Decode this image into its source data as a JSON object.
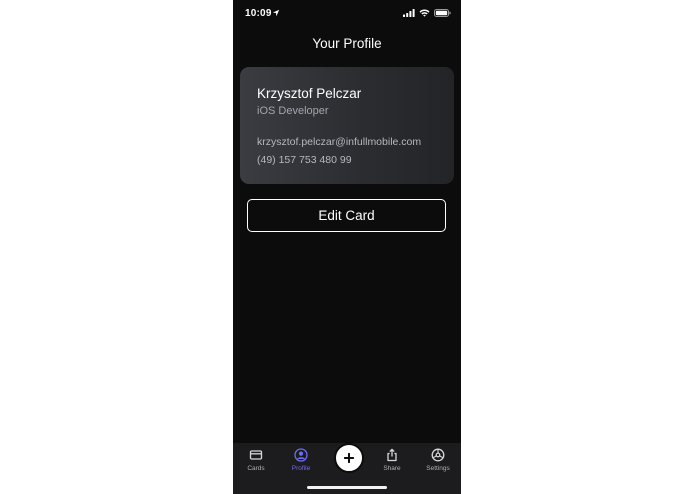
{
  "status_bar": {
    "time": "10:09",
    "location_icon": "location-arrow-icon",
    "signal_icon": "cellular-signal-icon",
    "wifi_icon": "wifi-icon",
    "battery_icon": "battery-icon"
  },
  "header": {
    "title": "Your Profile"
  },
  "profile_card": {
    "name": "Krzysztof Pelczar",
    "role": "iOS Developer",
    "email": "krzysztof.pelczar@infullmobile.com",
    "phone": "(49) 157 753 480 99"
  },
  "actions": {
    "edit_label": "Edit Card"
  },
  "tab_bar": {
    "items": [
      {
        "label": "Cards",
        "icon": "card-icon",
        "active": false
      },
      {
        "label": "Profile",
        "icon": "profile-icon",
        "active": true
      },
      {
        "label": "",
        "icon": "plus-icon",
        "active": false
      },
      {
        "label": "Share",
        "icon": "share-icon",
        "active": false
      },
      {
        "label": "Settings",
        "icon": "settings-icon",
        "active": false
      }
    ]
  },
  "colors": {
    "background": "#0c0c0d",
    "accent": "#6d6cf0",
    "tab_bar": "#1c1c1f",
    "card_gradient_start": "#3b3c41",
    "card_gradient_end": "#232428"
  }
}
